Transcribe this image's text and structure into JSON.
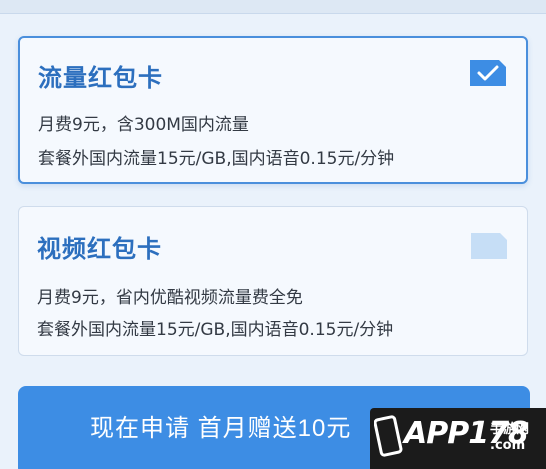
{
  "plans": [
    {
      "title": "流量红包卡",
      "line1": "月费9元，含300M国内流量",
      "line2": "套餐外国内流量15元/GB,国内语音0.15元/分钟",
      "selected": true
    },
    {
      "title": "视频红包卡",
      "line1": "月费9元，省内优酷视频流量费全免",
      "line2": "套餐外国内流量15元/GB,国内语音0.15元/分钟",
      "selected": false
    }
  ],
  "apply_button": {
    "label": "现在申请 首月赠送10元"
  },
  "watermark": {
    "main": "APP178",
    "side": "手游网",
    "domain": ".com"
  },
  "colors": {
    "accent": "#3d8de4",
    "title": "#2c6fbe",
    "background": "#eaf2fb",
    "unselected_tag": "#c6def6"
  }
}
